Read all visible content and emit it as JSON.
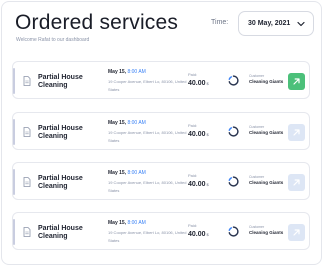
{
  "header": {
    "title": "Ordered services",
    "subtitle": "Welcome Rafat to our dashboard",
    "time_label": "Time:",
    "date_value": "30 May, 2021"
  },
  "orders": [
    {
      "service": "Partial House Cleaning",
      "date": "May 15,",
      "time": "8:00 AM",
      "address": "19 Cooper Avenue, Elbert Lo, 80106, United States",
      "paid_label": "Paid:",
      "paid_value": "40.00",
      "currency": "$",
      "customer_label": "Customer",
      "customer_name": "Cleaning Giants",
      "action_state": "active"
    },
    {
      "service": "Partial House Cleaning",
      "date": "May 15,",
      "time": "8:00 AM",
      "address": "19 Cooper Avenue, Elbert Lo, 80106, United States",
      "paid_label": "Paid:",
      "paid_value": "40.00",
      "currency": "$",
      "customer_label": "Customer",
      "customer_name": "Cleaning Giants",
      "action_state": "inactive"
    },
    {
      "service": "Partial House Cleaning",
      "date": "May 15,",
      "time": "8:00 AM",
      "address": "19 Cooper Avenue, Elbert Lo, 80106, United States",
      "paid_label": "Paid:",
      "paid_value": "40.00",
      "currency": "$",
      "customer_label": "Customer",
      "customer_name": "Cleaning Giants",
      "action_state": "inactive"
    },
    {
      "service": "Partial House Cleaning",
      "date": "May 15,",
      "time": "8:00 AM",
      "address": "19 Cooper Avenue, Elbert Lo, 80106, United States",
      "paid_label": "Paid:",
      "paid_value": "40.00",
      "currency": "$",
      "customer_label": "Customer",
      "customer_name": "Cleaning Giants",
      "action_state": "inactive"
    }
  ],
  "colors": {
    "accent_blue": "#3b82f6",
    "active_action": "#4cc07a",
    "inactive_action": "#dde6f5"
  },
  "icons": {
    "document": "document-icon",
    "company_logo": "company-logo-icon",
    "arrow": "arrow-up-right-icon",
    "chevron": "chevron-down-icon"
  }
}
